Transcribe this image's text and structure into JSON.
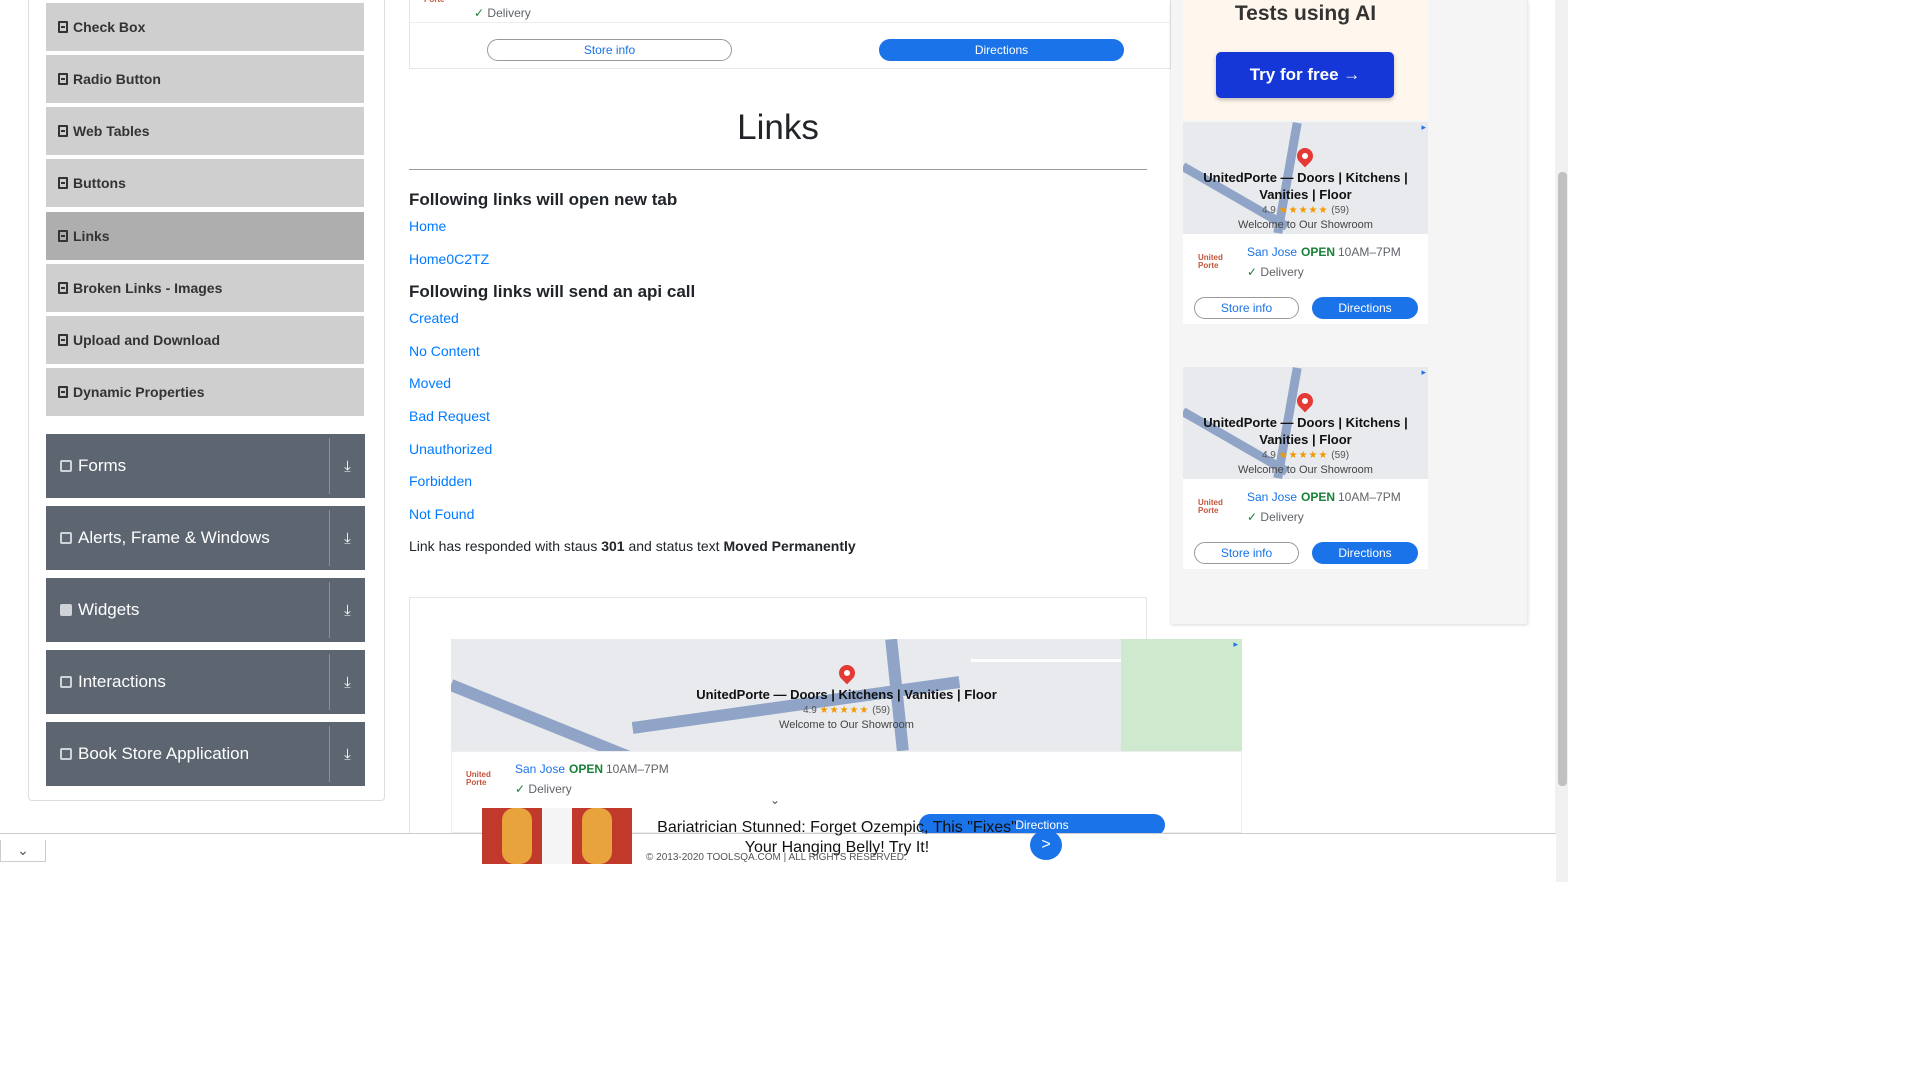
{
  "sidebar": {
    "items": [
      {
        "label": "Check Box"
      },
      {
        "label": "Radio Button"
      },
      {
        "label": "Web Tables"
      },
      {
        "label": "Buttons"
      },
      {
        "label": "Links"
      },
      {
        "label": "Broken Links - Images"
      },
      {
        "label": "Upload and Download"
      },
      {
        "label": "Dynamic Properties"
      }
    ],
    "active_item": "Links",
    "groups": [
      {
        "label": "Forms",
        "icon": "form-icon"
      },
      {
        "label": "Alerts, Frame & Windows",
        "icon": "window-icon"
      },
      {
        "label": "Widgets",
        "icon": "widgets-icon"
      },
      {
        "label": "Interactions",
        "icon": "interactions-icon"
      },
      {
        "label": "Book Store Application",
        "icon": "bookstore-icon"
      }
    ]
  },
  "main": {
    "title": "Links",
    "section_new_tab": "Following links will open new tab",
    "new_tab_links": [
      "Home",
      "Home0C2TZ"
    ],
    "section_api": "Following links will send an api call",
    "api_links": [
      "Created",
      "No Content",
      "Moved",
      "Bad Request",
      "Unauthorized",
      "Forbidden",
      "Not Found"
    ],
    "response": {
      "prefix": "Link has responded with staus",
      "status": "301",
      "middle": "and status text",
      "status_text": "Moved Permanently"
    }
  },
  "ads": {
    "top_delivery": "Delivery",
    "store_info": "Store info",
    "directions": "Directions",
    "ai_text": "Tests using AI",
    "try_free": "Try for free →",
    "map_title": "UnitedPorte — Doors | Kitchens | Vanities | Floor",
    "map_title_line1": "UnitedPorte — Doors | Kitchens |",
    "map_title_line2": "Vanities | Floor",
    "rating": "4.9",
    "stars": "★★★★★",
    "rating_count": "(59)",
    "welcome": "Welcome to Our Showroom",
    "place": "San Jose",
    "open": "OPEN",
    "hours": "10AM–7PM",
    "delivery": "Delivery",
    "logo_line1": "United",
    "logo_line2": "Porte",
    "bottom_text": "Bariatrician Stunned: Forget Ozempic, This \"Fixes\" Your Hanging Belly! Try It!",
    "next": ">"
  },
  "footer": {
    "text": "© 2013-2020 TOOLSQA.COM | ALL RIGHTS RESERVED."
  },
  "colors": {
    "link": "#007bff",
    "group_bg": "#5d6670",
    "item_bg": "#cfcfcf",
    "active_bg": "#aeaeae",
    "ad_blue": "#1a73e8",
    "cta_blue": "#1637d8"
  }
}
